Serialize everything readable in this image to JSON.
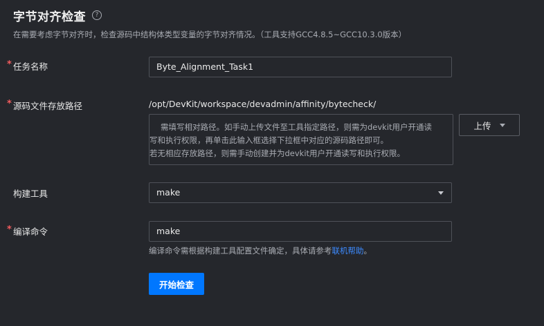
{
  "header": {
    "title": "字节对齐检查",
    "help_icon": "?",
    "subtitle": "在需要考虑字节对齐时，检查源码中结构体类型变量的字节对齐情况。（工具支持GCC4.8.5~GCC10.3.0版本）"
  },
  "form": {
    "required_mark": "*",
    "task_name": {
      "label": "任务名称",
      "value": "Byte_Alignment_Task1"
    },
    "source_path": {
      "label": "源码文件存放路径",
      "base_path": "/opt/DevKit/workspace/devadmin/affinity/bytecheck/",
      "placeholder_lines": [
        "需填写相对路径。如手动上传文件至工具指定路径，则需为devkit用户开通读",
        "写和执行权限，再单击此输入框选择下拉框中对应的源码路径即可。",
        "若无相应存放路径，则需手动创建并为devkit用户开通读写和执行权限。"
      ],
      "upload_label": "上传"
    },
    "build_tool": {
      "label": "构建工具",
      "selected": "make"
    },
    "compile_cmd": {
      "label": "编译命令",
      "value": "make",
      "hint_prefix": "编译命令需根据构建工具配置文件确定，具体请参考",
      "hint_link": "联机帮助",
      "hint_suffix": "。"
    }
  },
  "actions": {
    "start_label": "开始检查"
  },
  "colors": {
    "background": "#25272c",
    "accent": "#0077ff",
    "link": "#3d8bff",
    "required": "#f45c5e"
  }
}
